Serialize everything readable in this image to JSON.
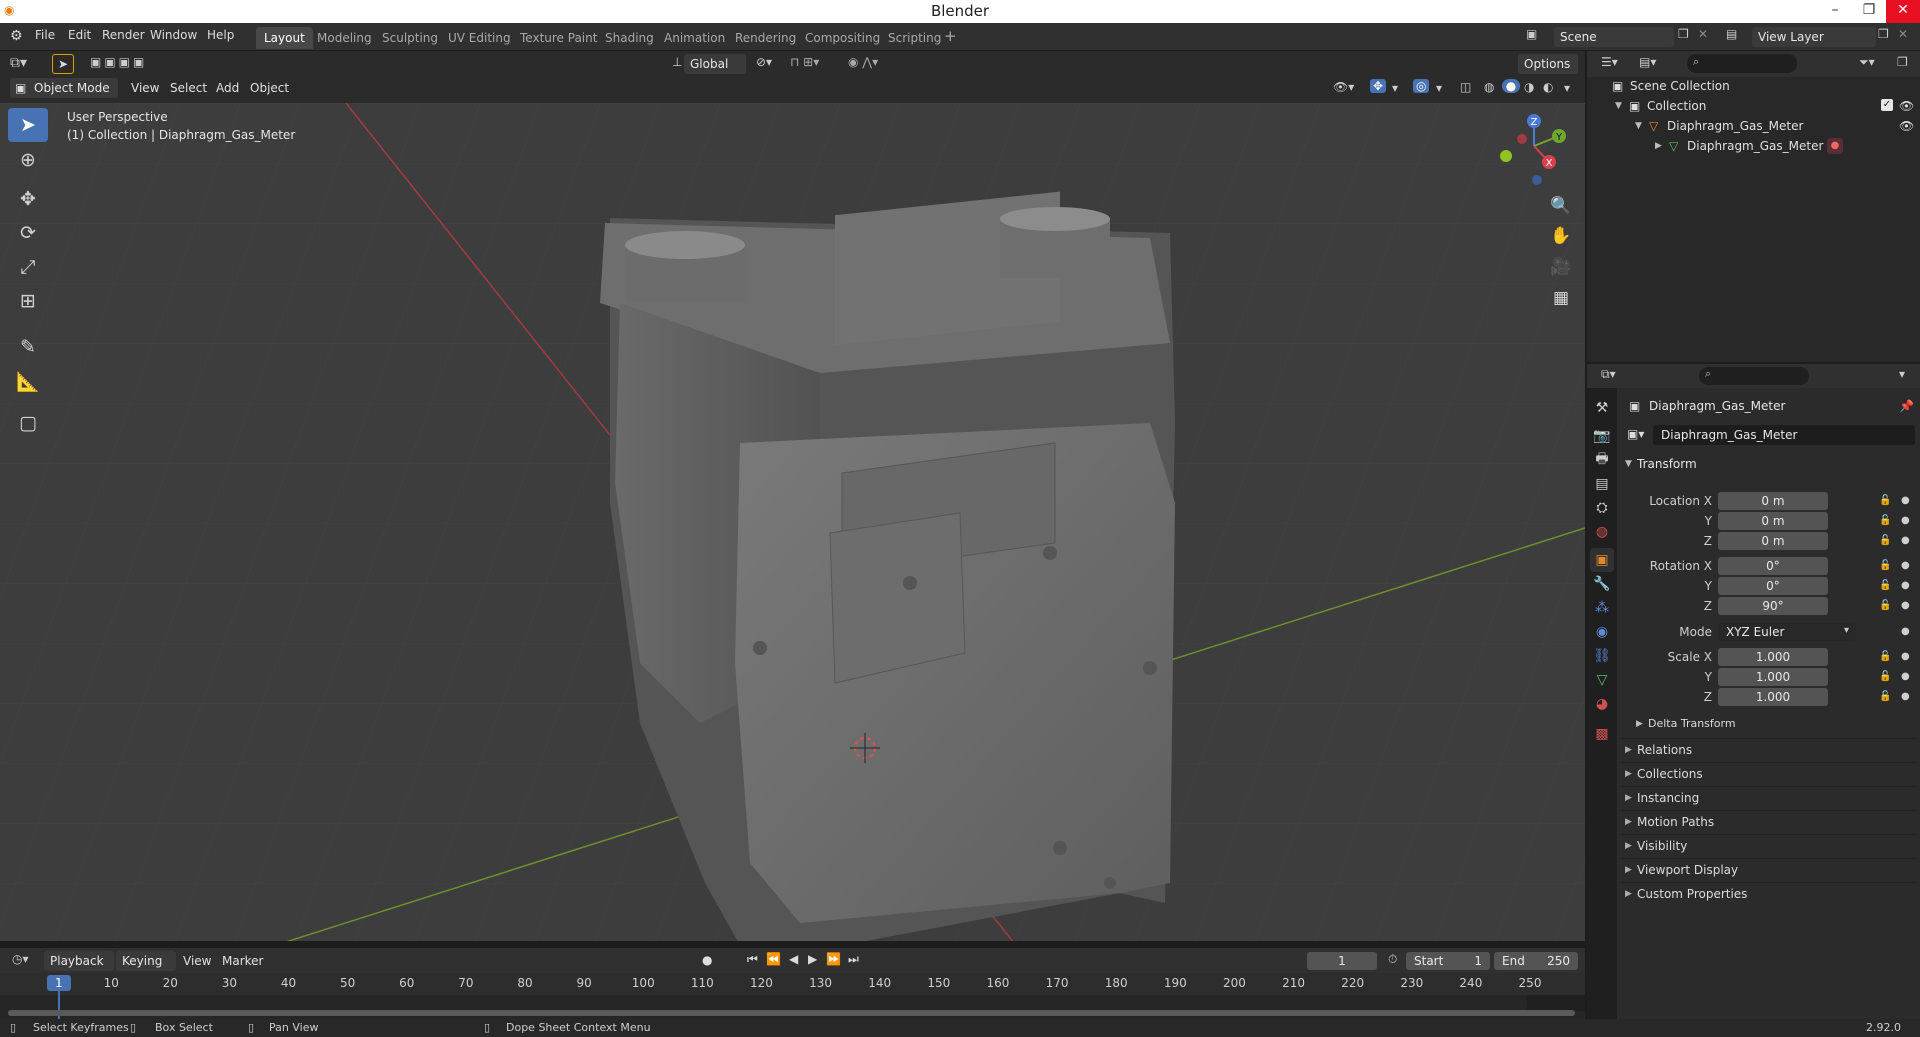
{
  "app": {
    "title": "Blender",
    "version": "2.92.0"
  },
  "menu": [
    "File",
    "Edit",
    "Render",
    "Window",
    "Help"
  ],
  "workspaces": [
    "Layout",
    "Modeling",
    "Sculpting",
    "UV Editing",
    "Texture Paint",
    "Shading",
    "Animation",
    "Rendering",
    "Compositing",
    "Scripting"
  ],
  "active_workspace": "Layout",
  "scene": {
    "name": "Scene",
    "view_layer": "View Layer"
  },
  "viewport": {
    "mode": "Object Mode",
    "menus": [
      "View",
      "Select",
      "Add",
      "Object"
    ],
    "orientation": "Global",
    "options": "Options",
    "perspective": "User Perspective",
    "collection_info": "(1) Collection | Diaphragm_Gas_Meter",
    "gizmo_labels": {
      "z": "Z",
      "y": "Y",
      "x": "X"
    }
  },
  "outliner": {
    "scene_collection": "Scene Collection",
    "collection": "Collection",
    "object": "Diaphragm_Gas_Meter",
    "mesh": "Diaphragm_Gas_Meter"
  },
  "properties": {
    "object_name": "Diaphragm_Gas_Meter",
    "datablock": "Diaphragm_Gas_Meter",
    "transform_title": "Transform",
    "location": {
      "label": "Location X",
      "x": "0 m",
      "y": "0 m",
      "z": "0 m"
    },
    "rotation": {
      "label": "Rotation X",
      "x": "0°",
      "y": "0°",
      "z": "90°"
    },
    "mode_label": "Mode",
    "mode_value": "XYZ Euler",
    "scale": {
      "label": "Scale X",
      "x": "1.000",
      "y": "1.000",
      "z": "1.000"
    },
    "axis": {
      "y": "Y",
      "z": "Z"
    },
    "delta": "Delta Transform",
    "panels": [
      "Relations",
      "Collections",
      "Instancing",
      "Motion Paths",
      "Visibility",
      "Viewport Display",
      "Custom Properties"
    ]
  },
  "timeline": {
    "menus": [
      "Playback",
      "Keying",
      "View",
      "Marker"
    ],
    "current_frame": "1",
    "start_label": "Start",
    "start": "1",
    "end_label": "End",
    "end": "250",
    "ticks": [
      "1",
      "10",
      "20",
      "30",
      "40",
      "50",
      "60",
      "70",
      "80",
      "90",
      "100",
      "110",
      "120",
      "130",
      "140",
      "150",
      "160",
      "170",
      "180",
      "190",
      "200",
      "210",
      "220",
      "230",
      "240",
      "250"
    ]
  },
  "status": {
    "select": "Select Keyframes",
    "box": "Box Select",
    "pan": "Pan View",
    "context": "Dope Sheet Context Menu"
  },
  "colors": {
    "accent": "#4772b3",
    "axis_x": "#b5333d",
    "axis_y": "#6b8f23",
    "object_orange": "#e08a2c"
  }
}
